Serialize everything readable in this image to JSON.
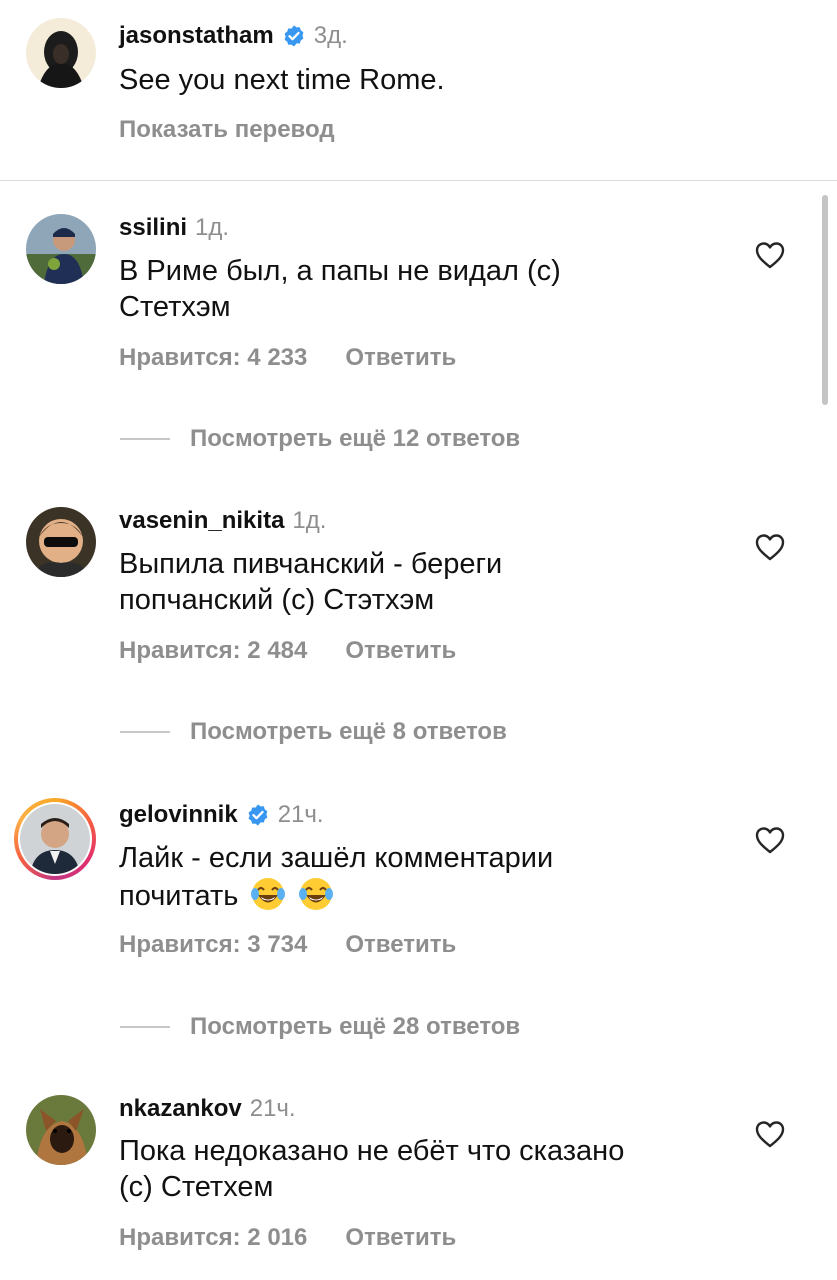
{
  "caption": {
    "username": "jasonstatham",
    "verified": true,
    "time": "3д.",
    "text": "See you next time Rome.",
    "translate_label": "Показать перевод"
  },
  "comments": [
    {
      "username": "ssilini",
      "verified": false,
      "time": "1д.",
      "text_line1": "В Риме был, а папы не видал (с)",
      "text_line2": "Стетхэм",
      "likes_label": "Нравится: 4 233",
      "reply_label": "Ответить",
      "view_replies_label": "Посмотреть ещё 12 ответов"
    },
    {
      "username": "vasenin_nikita",
      "verified": false,
      "time": "1д.",
      "text_line1": "Выпила пивчанский - береги",
      "text_line2": "попчанский (с) Стэтхэм",
      "likes_label": "Нравится: 2 484",
      "reply_label": "Ответить",
      "view_replies_label": "Посмотреть ещё 8 ответов"
    },
    {
      "username": "gelovinnik",
      "verified": true,
      "time": "21ч.",
      "text_line1": "Лайк - если зашёл комментарии",
      "text_line2": "почитать",
      "likes_label": "Нравится: 3 734",
      "reply_label": "Ответить",
      "view_replies_label": "Посмотреть ещё 28 ответов"
    },
    {
      "username": "nkazankov",
      "verified": false,
      "time": "21ч.",
      "text_line1": "Пока недоказано не ебёт что сказано",
      "text_line2": "(с)  Стетхем",
      "likes_label": "Нравится: 2 016",
      "reply_label": "Ответить"
    }
  ],
  "icons": {
    "verified": "verified-badge-icon",
    "like": "heart-outline-icon",
    "emoji": "face-with-tears-of-joy"
  },
  "colors": {
    "verified_blue": "#3897f0",
    "secondary_text": "#8e8e8e",
    "divider": "#dbdbdb",
    "story_ring": "#e1306c"
  }
}
